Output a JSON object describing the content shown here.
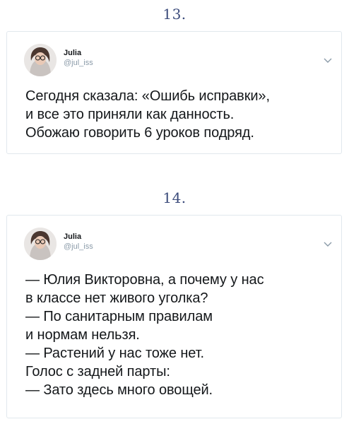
{
  "tweets": [
    {
      "number": "13.",
      "author_name": "Julia",
      "author_handle": "@jul_iss",
      "avatar_icon": "user-avatar-photo",
      "menu_icon": "chevron-down-icon",
      "text": "Сегодня сказала: «Ошибь исправки»,\nи все это приняли как данность.\nОбожаю говорить 6 уроков подряд."
    },
    {
      "number": "14.",
      "author_name": "Julia",
      "author_handle": "@jul_iss",
      "avatar_icon": "user-avatar-photo",
      "menu_icon": "chevron-down-icon",
      "text": "— Юлия Викторовна, а почему у нас\nв классе нет живого уголка?\n— По санитарным правилам\nи нормам нельзя.\n— Растений у нас тоже нет.\nГолос с задней парты:\n— Зато здесь много овощей."
    }
  ],
  "colors": {
    "number": "#3a4a7a",
    "border": "#e1e8ed",
    "text": "#14171a",
    "muted": "#8a9aa8"
  }
}
